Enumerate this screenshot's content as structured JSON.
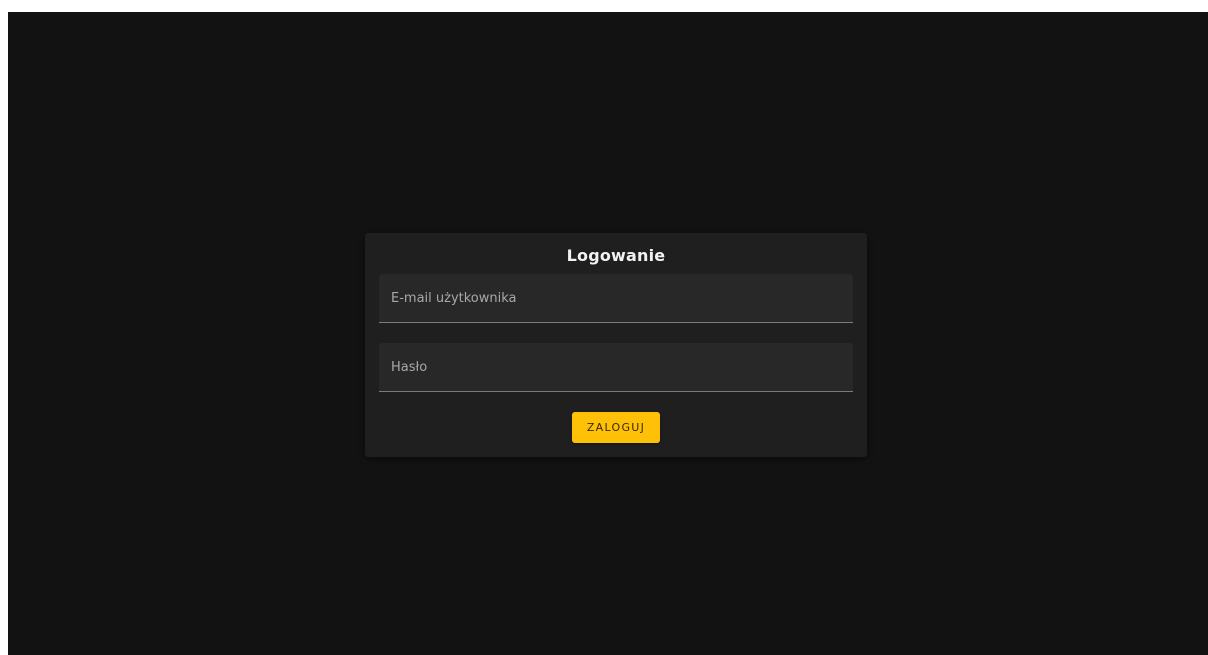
{
  "login": {
    "title": "Logowanie",
    "email_placeholder": "E-mail użytkownika",
    "email_value": "",
    "password_placeholder": "Hasło",
    "password_value": "",
    "submit_label": "ZALOGUJ"
  },
  "colors": {
    "background": "#121212",
    "card": "#1f1f1f",
    "field": "#282828",
    "accent": "#ffc107"
  }
}
